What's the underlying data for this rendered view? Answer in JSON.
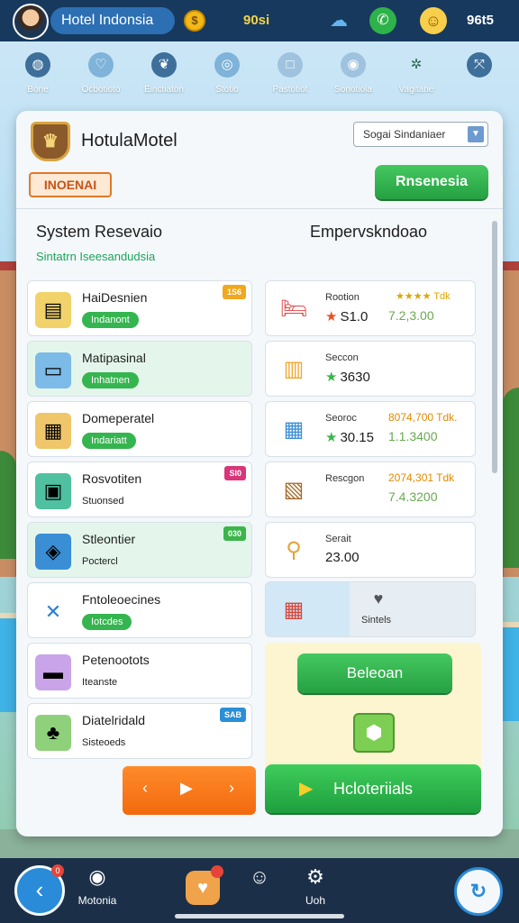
{
  "header": {
    "title": "Hotel Indonsia",
    "coin_value": "90si",
    "right_value": "96t5",
    "icons": [
      "avatar",
      "coin-icon",
      "cloud-icon",
      "chat-icon",
      "smile-icon"
    ]
  },
  "nav": [
    {
      "label": "Bone",
      "icon": "globe-icon",
      "color": "#3d6f9a"
    },
    {
      "label": "Ocbotioto",
      "icon": "heart-icon",
      "color": "#7fb3d9"
    },
    {
      "label": "Einctiaton",
      "icon": "leaf-icon",
      "color": "#3d6f9a"
    },
    {
      "label": "Stotio",
      "icon": "compass-icon",
      "color": "#7fb3d9"
    },
    {
      "label": "Pastotiot",
      "icon": "square-icon",
      "color": "#9fc3de"
    },
    {
      "label": "Sonotiola",
      "icon": "circle-icon",
      "color": "#9fc3de"
    },
    {
      "label": "Vagitane",
      "icon": "star-icon",
      "color": "transparent"
    },
    {
      "label": "",
      "icon": "expand-icon",
      "color": "#3d6f9a"
    }
  ],
  "panel": {
    "logo_glyph": "♛",
    "hotel_name": "HotulaMotel",
    "dropdown_value": "Sogai Sindaniaer",
    "badge": "INOENAI",
    "reserve_label": "Rnsenesia",
    "left_title": "System Resevaio",
    "left_subtitle": "Sintatrn Iseesandudsia",
    "right_title": "Empervskndoao"
  },
  "left_items": [
    {
      "name": "HaiDesnien",
      "status": "Indanont",
      "tag": "1S6",
      "tag_color": "#f0a820",
      "icon": "register-icon",
      "glyph": "▤",
      "icon_bg": "#f2d36b",
      "alt": false,
      "plain": false
    },
    {
      "name": "Matipasinal",
      "status": "Inhatnen",
      "tag": "",
      "tag_color": "",
      "icon": "computer-icon",
      "glyph": "▭",
      "icon_bg": "#7cbbe8",
      "alt": true,
      "plain": false
    },
    {
      "name": "Domeperatel",
      "status": "Indariatt",
      "tag": "",
      "tag_color": "",
      "icon": "document-icon",
      "glyph": "▦",
      "icon_bg": "#f0c66b",
      "alt": false,
      "plain": false
    },
    {
      "name": "Rosvotiten",
      "status": "Stuonsed",
      "tag": "SI0",
      "tag_color": "#d9357a",
      "icon": "keycard-icon",
      "glyph": "▣",
      "icon_bg": "#4fc0a0",
      "alt": false,
      "plain": true
    },
    {
      "name": "Stleontier",
      "status": "Poctercl",
      "tag": "030",
      "tag_color": "#3bb54a",
      "icon": "tablet-icon",
      "glyph": "◈",
      "icon_bg": "#3a8ed6",
      "alt": true,
      "plain": true
    },
    {
      "name": "Fntoleoecines",
      "status": "Iotcdes",
      "tag": "",
      "tag_color": "",
      "icon": "tools-icon",
      "glyph": "✕",
      "icon_bg": "#ffffff",
      "alt": false,
      "plain": false
    },
    {
      "name": "Petenootots",
      "status": "Iteanste",
      "tag": "",
      "tag_color": "",
      "icon": "laptop-icon",
      "glyph": "▬",
      "icon_bg": "#c9a4e8",
      "alt": false,
      "plain": true
    },
    {
      "name": "Diatelridald",
      "status": "Sisteoeds",
      "tag": "SAB",
      "tag_color": "#2b8fd6",
      "icon": "plant-icon",
      "glyph": "♣",
      "icon_bg": "#8fd17a",
      "alt": false,
      "plain": true
    }
  ],
  "right_items": [
    {
      "label": "Rootion",
      "value": "S1.0",
      "star": "★",
      "star_color": "#e8512a",
      "stars": "★★★★ Tdk",
      "price": "",
      "green": "7.2,3.00",
      "icon": "bed-icon",
      "glyph": "🛏",
      "icon_color": "#e04848"
    },
    {
      "label": "Seccon",
      "value": "3630",
      "star": "★",
      "star_color": "#3bb54a",
      "stars": "",
      "price": "",
      "green": "",
      "icon": "briefcase-icon",
      "glyph": "▥",
      "icon_color": "#f0a830"
    },
    {
      "label": "Seoroc",
      "value": "30.15",
      "star": "★",
      "star_color": "#3bb54a",
      "stars": "",
      "price": "8074,700 Tdk.",
      "green": "1.1.3400",
      "icon": "box-icon",
      "glyph": "▦",
      "icon_color": "#3a8ed6"
    },
    {
      "label": "Rescgon",
      "value": "",
      "star": "",
      "star_color": "",
      "stars": "",
      "price": "2074,301 Tdk",
      "green": "7.4.3200",
      "icon": "frame-icon",
      "glyph": "▧",
      "icon_color": "#a66a2a"
    },
    {
      "label": "Serait",
      "value": "23.00",
      "star": "",
      "star_color": "",
      "stars": "",
      "price": "",
      "green": "",
      "icon": "search-icon",
      "glyph": "⚲",
      "icon_color": "#e6a23a"
    }
  ],
  "map_card": {
    "label": "Sintels",
    "pin_glyph": "♥"
  },
  "cta": {
    "label": "Beleoan",
    "cube_glyph": "⬢"
  },
  "pager": {
    "prev": "‹",
    "play": "▶",
    "next": "›"
  },
  "play_button": {
    "icon": "▶",
    "label": "Hcloteriials"
  },
  "bottom": {
    "back_glyph": "‹",
    "back_badge": "0",
    "item1_label": "Motonia",
    "item1_glyph": "◉",
    "heart_glyph": "♥",
    "item3_glyph": "☺",
    "item4_label": "Uoh",
    "item4_glyph": "⚙",
    "refresh_glyph": "↻"
  }
}
